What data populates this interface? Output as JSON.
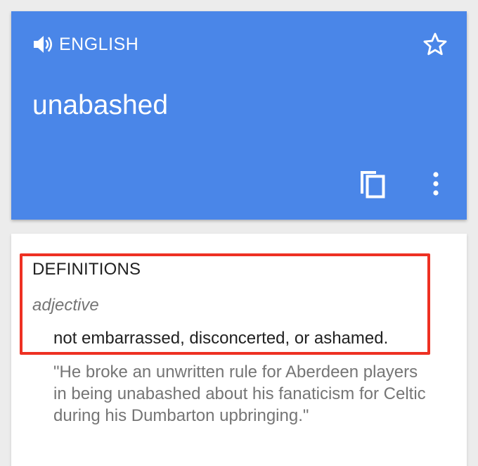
{
  "translation_card": {
    "language": "ENGLISH",
    "word": "unabashed",
    "icons": {
      "speaker": "speaker-icon",
      "star": "star-outline-icon",
      "copy": "copy-icon",
      "more": "more-vert-icon"
    },
    "background_color": "#4a86e8"
  },
  "definitions_card": {
    "heading": "DEFINITIONS",
    "part_of_speech": "adjective",
    "definition": "not embarrassed, disconcerted, or ashamed.",
    "example": "\"He broke an unwritten rule for Aberdeen players in being unabashed about his fanaticism for Celtic during his Dumbarton upbringing.\"",
    "highlight_color": "#ee3123"
  }
}
